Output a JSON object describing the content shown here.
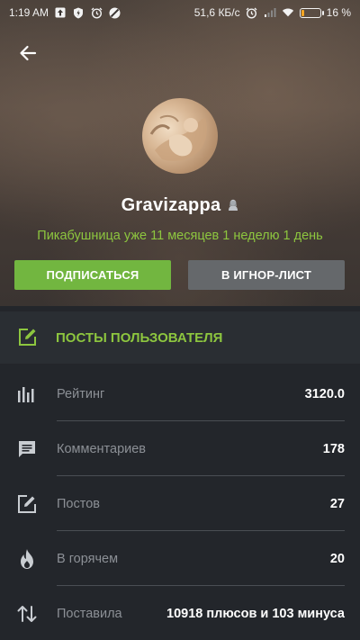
{
  "status_bar": {
    "time": "1:19 AM",
    "speed": "51,6 КБ/с",
    "battery": "16 %",
    "battery_level": 0.16
  },
  "profile": {
    "username": "Gravizappa",
    "tenure": "Пикабушница уже 11 месяцев 1 неделю 1 день"
  },
  "actions": {
    "subscribe_label": "ПОДПИСАТЬСЯ",
    "ignore_label": "В ИГНОР-ЛИСТ"
  },
  "posts_section": {
    "label": "ПОСТЫ ПОЛЬЗОВАТЕЛЯ"
  },
  "stats": [
    {
      "icon": "rating-icon",
      "label": "Рейтинг",
      "value": "3120.0"
    },
    {
      "icon": "comments-icon",
      "label": "Комментариев",
      "value": "178"
    },
    {
      "icon": "posts-icon",
      "label": "Постов",
      "value": "27"
    },
    {
      "icon": "hot-icon",
      "label": "В горячем",
      "value": "20"
    },
    {
      "icon": "votes-icon",
      "label": "Поставила",
      "value": "10918 плюсов и 103 минуса"
    }
  ],
  "colors": {
    "accent_green": "#8dc63f",
    "button_green": "#72b640",
    "button_grey": "#65686b",
    "background": "#23262b"
  }
}
